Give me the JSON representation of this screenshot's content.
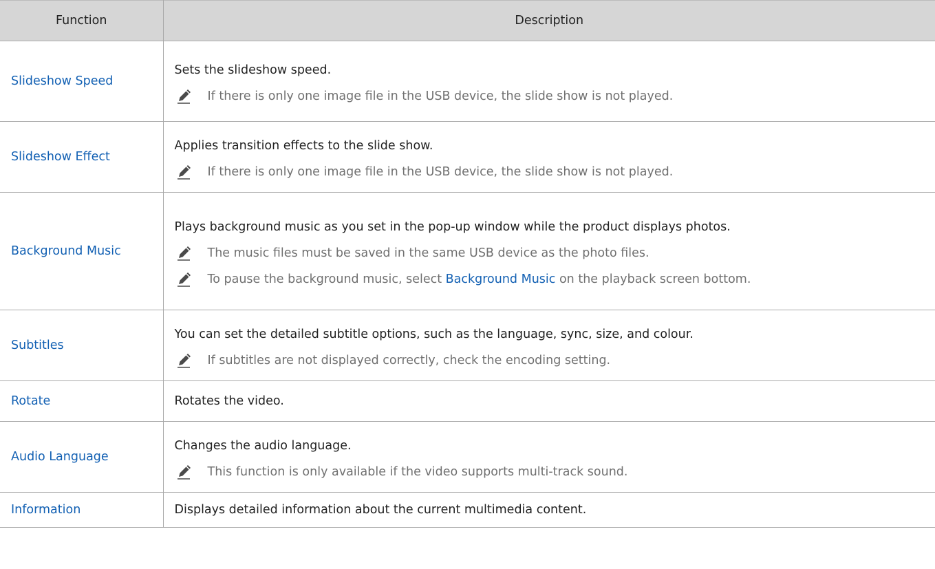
{
  "table": {
    "headers": {
      "function": "Function",
      "description": "Description"
    },
    "rows": [
      {
        "function": "Slideshow Speed",
        "description": "Sets the slideshow speed.",
        "notes": [
          {
            "text": "If there is only one image file in the USB device, the slide show is not played."
          }
        ]
      },
      {
        "function": "Slideshow Effect",
        "description": "Applies transition effects to the slide show.",
        "notes": [
          {
            "text": "If there is only one image file in the USB device, the slide show is not played."
          }
        ]
      },
      {
        "function": "Background Music",
        "description": "Plays background music as you set in the pop-up window while the product displays photos.",
        "notes": [
          {
            "text": "The music files must be saved in the same USB device as the photo files."
          },
          {
            "pre": "To pause the background music, select ",
            "link": "Background Music",
            "post": " on the playback screen bottom."
          }
        ]
      },
      {
        "function": "Subtitles",
        "description": "You can set the detailed subtitle options, such as the language, sync, size, and colour.",
        "notes": [
          {
            "text": "If subtitles are not displayed correctly, check the encoding setting."
          }
        ]
      },
      {
        "function": "Rotate",
        "description": "Rotates the video.",
        "notes": []
      },
      {
        "function": "Audio Language",
        "description": "Changes the audio language.",
        "notes": [
          {
            "text": "This function is only available if the video supports multi-track sound."
          }
        ]
      },
      {
        "function": "Information",
        "description": "Displays detailed information about the current multimedia content.",
        "notes": []
      }
    ]
  },
  "icons": {
    "note": "pencil-note-icon"
  },
  "colors": {
    "header_bg": "#d6d6d6",
    "link": "#1260b3",
    "note_text": "#707070",
    "body_text": "#222222",
    "border": "#a9a9a9"
  }
}
